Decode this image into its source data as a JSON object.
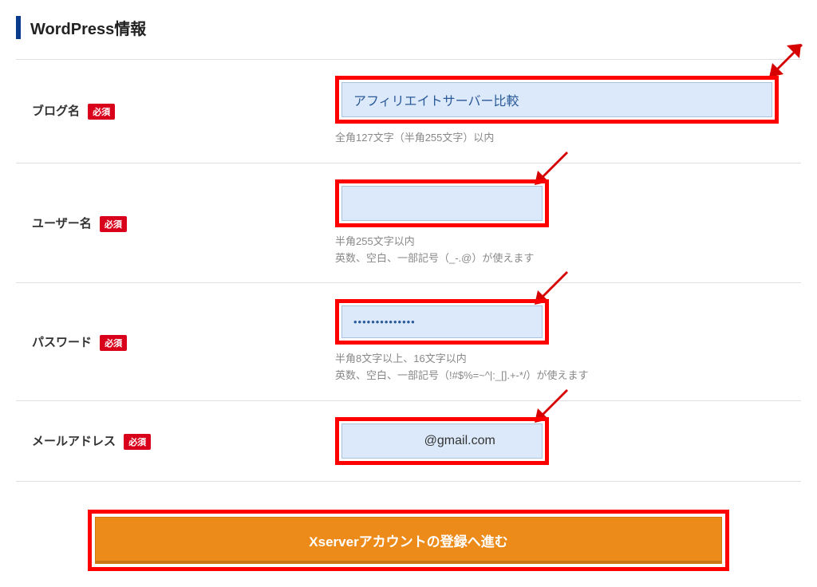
{
  "section_title": "WordPress情報",
  "required_label": "必須",
  "fields": {
    "blog_name": {
      "label": "ブログ名",
      "value": "アフィリエイトサーバー比較",
      "hint": "全角127文字（半角255文字）以内"
    },
    "user_name": {
      "label": "ユーザー名",
      "value": "",
      "hint1": "半角255文字以内",
      "hint2": "英数、空白、一部記号（_-.@）が使えます"
    },
    "password": {
      "label": "パスワード",
      "value": "••••••••••••••",
      "hint1": "半角8文字以上、16文字以内",
      "hint2": "英数、空白、一部記号（!#$%=~^|:_[].+-*/）が使えます"
    },
    "email": {
      "label": "メールアドレス",
      "value": "          @gmail.com"
    }
  },
  "submit_label": "Xserverアカウントの登録へ進む"
}
